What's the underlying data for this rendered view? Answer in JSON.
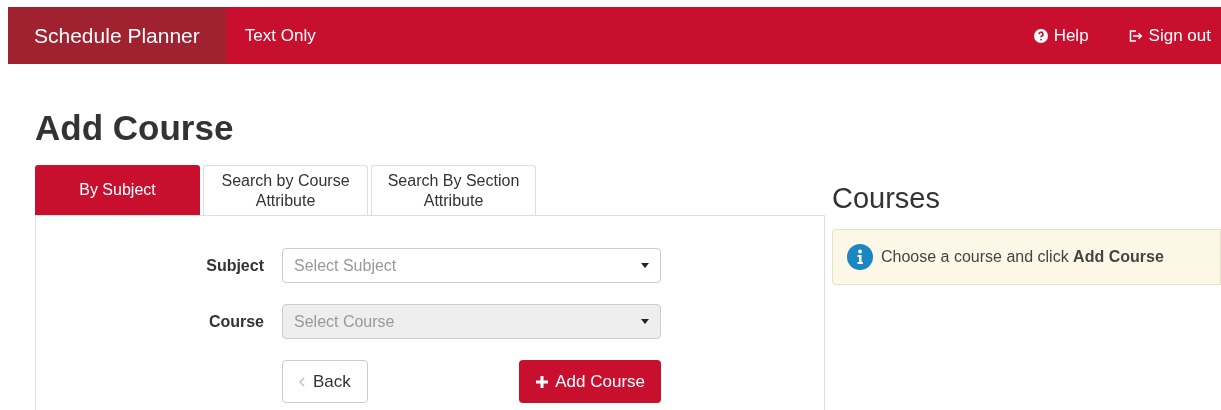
{
  "navbar": {
    "brand": "Schedule Planner",
    "links": [
      {
        "label": "Text Only"
      }
    ],
    "right_links": [
      {
        "kind": "help",
        "label": "Help"
      },
      {
        "kind": "signout",
        "label": "Sign out"
      }
    ]
  },
  "page_title": "Add Course",
  "tabs": [
    {
      "label": "By Subject",
      "selected": true
    },
    {
      "label": "Search by Course Attribute",
      "selected": false
    },
    {
      "label": "Search By Section Attribute",
      "selected": false
    }
  ],
  "form": {
    "fields": [
      {
        "label": "Subject",
        "placeholder": "Select Subject",
        "disabled": false
      },
      {
        "label": "Course",
        "placeholder": "Select Course",
        "disabled": true
      }
    ],
    "back_button": "Back",
    "add_button": "Add Course"
  },
  "courses": {
    "title": "Courses",
    "message": "Choose a course and click **Add Course**"
  }
}
